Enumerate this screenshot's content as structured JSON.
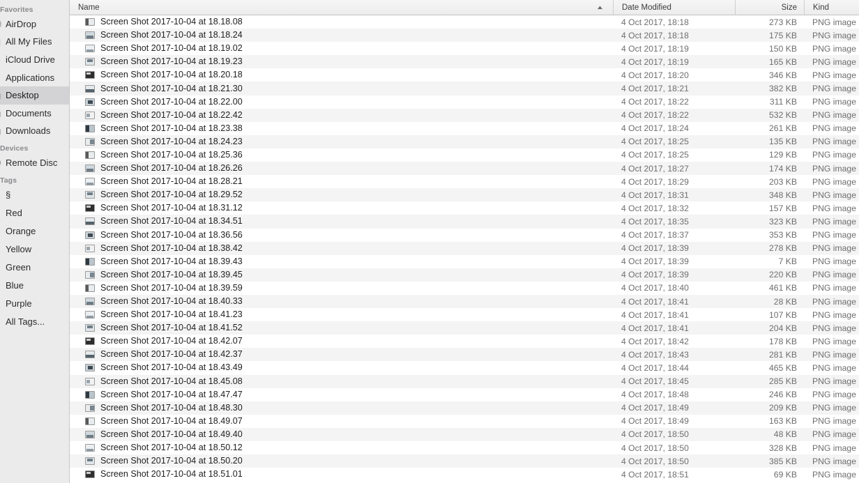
{
  "window": {
    "app": "Finder",
    "view": "list",
    "selected_location": "Desktop"
  },
  "sidebar": {
    "groups": [
      {
        "label": "Favorites",
        "items": [
          {
            "label": "AirDrop",
            "icon": "airdrop-icon",
            "selected": false
          },
          {
            "label": "All My Files",
            "icon": "all-my-files-icon",
            "selected": false
          },
          {
            "label": "iCloud Drive",
            "icon": "icloud-drive-icon",
            "selected": false
          },
          {
            "label": "Applications",
            "icon": "applications-icon",
            "selected": false
          },
          {
            "label": "Desktop",
            "icon": "desktop-folder-icon",
            "selected": true
          },
          {
            "label": "Documents",
            "icon": "documents-folder-icon",
            "selected": false
          },
          {
            "label": "Downloads",
            "icon": "downloads-folder-icon",
            "selected": false
          }
        ]
      },
      {
        "label": "Devices",
        "items": [
          {
            "label": "Remote Disc",
            "icon": "remote-disc-icon",
            "selected": false
          }
        ]
      },
      {
        "label": "Tags",
        "items": [
          {
            "label": "§",
            "icon": "tag-dot-gray-icon",
            "color": "#c8c8c8",
            "selected": false
          },
          {
            "label": "Red",
            "icon": "tag-dot-red-icon",
            "color": "#fc5b57",
            "selected": false
          },
          {
            "label": "Orange",
            "icon": "tag-dot-orange-icon",
            "color": "#fa9a38",
            "selected": false
          },
          {
            "label": "Yellow",
            "icon": "tag-dot-yellow-icon",
            "color": "#f6c42f",
            "selected": false
          },
          {
            "label": "Green",
            "icon": "tag-dot-green-icon",
            "color": "#63d246",
            "selected": false
          },
          {
            "label": "Blue",
            "icon": "tag-dot-blue-icon",
            "color": "#44a1f9",
            "selected": false
          },
          {
            "label": "Purple",
            "icon": "tag-dot-purple-icon",
            "color": "#c87ceb",
            "selected": false
          },
          {
            "label": "All Tags...",
            "icon": "all-tags-icon",
            "color": "",
            "selected": false
          }
        ]
      }
    ]
  },
  "file_list": {
    "columns": [
      {
        "key": "name",
        "label": "Name",
        "sorted": true,
        "sort_direction": "ascending"
      },
      {
        "key": "date",
        "label": "Date Modified",
        "sorted": false,
        "sort_direction": ""
      },
      {
        "key": "size",
        "label": "Size",
        "sorted": false,
        "sort_direction": ""
      },
      {
        "key": "kind",
        "label": "Kind",
        "sorted": false,
        "sort_direction": ""
      }
    ],
    "rows": [
      {
        "name": "Screen Shot 2017-10-04 at 18.18.08",
        "date": "4 Oct 2017, 18:18",
        "size": "273 KB",
        "kind": "PNG image"
      },
      {
        "name": "Screen Shot 2017-10-04 at 18.18.24",
        "date": "4 Oct 2017, 18:18",
        "size": "175 KB",
        "kind": "PNG image"
      },
      {
        "name": "Screen Shot 2017-10-04 at 18.19.02",
        "date": "4 Oct 2017, 18:19",
        "size": "150 KB",
        "kind": "PNG image"
      },
      {
        "name": "Screen Shot 2017-10-04 at 18.19.23",
        "date": "4 Oct 2017, 18:19",
        "size": "165 KB",
        "kind": "PNG image"
      },
      {
        "name": "Screen Shot 2017-10-04 at 18.20.18",
        "date": "4 Oct 2017, 18:20",
        "size": "346 KB",
        "kind": "PNG image"
      },
      {
        "name": "Screen Shot 2017-10-04 at 18.21.30",
        "date": "4 Oct 2017, 18:21",
        "size": "382 KB",
        "kind": "PNG image"
      },
      {
        "name": "Screen Shot 2017-10-04 at 18.22.00",
        "date": "4 Oct 2017, 18:22",
        "size": "311 KB",
        "kind": "PNG image"
      },
      {
        "name": "Screen Shot 2017-10-04 at 18.22.42",
        "date": "4 Oct 2017, 18:22",
        "size": "532 KB",
        "kind": "PNG image"
      },
      {
        "name": "Screen Shot 2017-10-04 at 18.23.38",
        "date": "4 Oct 2017, 18:24",
        "size": "261 KB",
        "kind": "PNG image"
      },
      {
        "name": "Screen Shot 2017-10-04 at 18.24.23",
        "date": "4 Oct 2017, 18:25",
        "size": "135 KB",
        "kind": "PNG image"
      },
      {
        "name": "Screen Shot 2017-10-04 at 18.25.36",
        "date": "4 Oct 2017, 18:25",
        "size": "129 KB",
        "kind": "PNG image"
      },
      {
        "name": "Screen Shot 2017-10-04 at 18.26.26",
        "date": "4 Oct 2017, 18:27",
        "size": "174 KB",
        "kind": "PNG image"
      },
      {
        "name": "Screen Shot 2017-10-04 at 18.28.21",
        "date": "4 Oct 2017, 18:29",
        "size": "203 KB",
        "kind": "PNG image"
      },
      {
        "name": "Screen Shot 2017-10-04 at 18.29.52",
        "date": "4 Oct 2017, 18:31",
        "size": "348 KB",
        "kind": "PNG image"
      },
      {
        "name": "Screen Shot 2017-10-04 at 18.31.12",
        "date": "4 Oct 2017, 18:32",
        "size": "157 KB",
        "kind": "PNG image"
      },
      {
        "name": "Screen Shot 2017-10-04 at 18.34.51",
        "date": "4 Oct 2017, 18:35",
        "size": "323 KB",
        "kind": "PNG image"
      },
      {
        "name": "Screen Shot 2017-10-04 at 18.36.56",
        "date": "4 Oct 2017, 18:37",
        "size": "353 KB",
        "kind": "PNG image"
      },
      {
        "name": "Screen Shot 2017-10-04 at 18.38.42",
        "date": "4 Oct 2017, 18:39",
        "size": "278 KB",
        "kind": "PNG image"
      },
      {
        "name": "Screen Shot 2017-10-04 at 18.39.43",
        "date": "4 Oct 2017, 18:39",
        "size": "7 KB",
        "kind": "PNG image"
      },
      {
        "name": "Screen Shot 2017-10-04 at 18.39.45",
        "date": "4 Oct 2017, 18:39",
        "size": "220 KB",
        "kind": "PNG image"
      },
      {
        "name": "Screen Shot 2017-10-04 at 18.39.59",
        "date": "4 Oct 2017, 18:40",
        "size": "461 KB",
        "kind": "PNG image"
      },
      {
        "name": "Screen Shot 2017-10-04 at 18.40.33",
        "date": "4 Oct 2017, 18:41",
        "size": "28 KB",
        "kind": "PNG image"
      },
      {
        "name": "Screen Shot 2017-10-04 at 18.41.23",
        "date": "4 Oct 2017, 18:41",
        "size": "107 KB",
        "kind": "PNG image"
      },
      {
        "name": "Screen Shot 2017-10-04 at 18.41.52",
        "date": "4 Oct 2017, 18:41",
        "size": "204 KB",
        "kind": "PNG image"
      },
      {
        "name": "Screen Shot 2017-10-04 at 18.42.07",
        "date": "4 Oct 2017, 18:42",
        "size": "178 KB",
        "kind": "PNG image"
      },
      {
        "name": "Screen Shot 2017-10-04 at 18.42.37",
        "date": "4 Oct 2017, 18:43",
        "size": "281 KB",
        "kind": "PNG image"
      },
      {
        "name": "Screen Shot 2017-10-04 at 18.43.49",
        "date": "4 Oct 2017, 18:44",
        "size": "465 KB",
        "kind": "PNG image"
      },
      {
        "name": "Screen Shot 2017-10-04 at 18.45.08",
        "date": "4 Oct 2017, 18:45",
        "size": "285 KB",
        "kind": "PNG image"
      },
      {
        "name": "Screen Shot 2017-10-04 at 18.47.47",
        "date": "4 Oct 2017, 18:48",
        "size": "246 KB",
        "kind": "PNG image"
      },
      {
        "name": "Screen Shot 2017-10-04 at 18.48.30",
        "date": "4 Oct 2017, 18:49",
        "size": "209 KB",
        "kind": "PNG image"
      },
      {
        "name": "Screen Shot 2017-10-04 at 18.49.07",
        "date": "4 Oct 2017, 18:49",
        "size": "163 KB",
        "kind": "PNG image"
      },
      {
        "name": "Screen Shot 2017-10-04 at 18.49.40",
        "date": "4 Oct 2017, 18:50",
        "size": "48 KB",
        "kind": "PNG image"
      },
      {
        "name": "Screen Shot 2017-10-04 at 18.50.12",
        "date": "4 Oct 2017, 18:50",
        "size": "328 KB",
        "kind": "PNG image"
      },
      {
        "name": "Screen Shot 2017-10-04 at 18.50.20",
        "date": "4 Oct 2017, 18:50",
        "size": "385 KB",
        "kind": "PNG image"
      },
      {
        "name": "Screen Shot 2017-10-04 at 18.51.01",
        "date": "4 Oct 2017, 18:51",
        "size": "69 KB",
        "kind": "PNG image"
      }
    ]
  },
  "colors": {
    "sidebar_bg": "#ebebeb",
    "selection_bg": "#d3d3d5",
    "row_stripe": "#f4f4f4",
    "header_bg": "#ececec",
    "text_primary": "#1f1f1f",
    "text_secondary": "#6e6e6e"
  }
}
